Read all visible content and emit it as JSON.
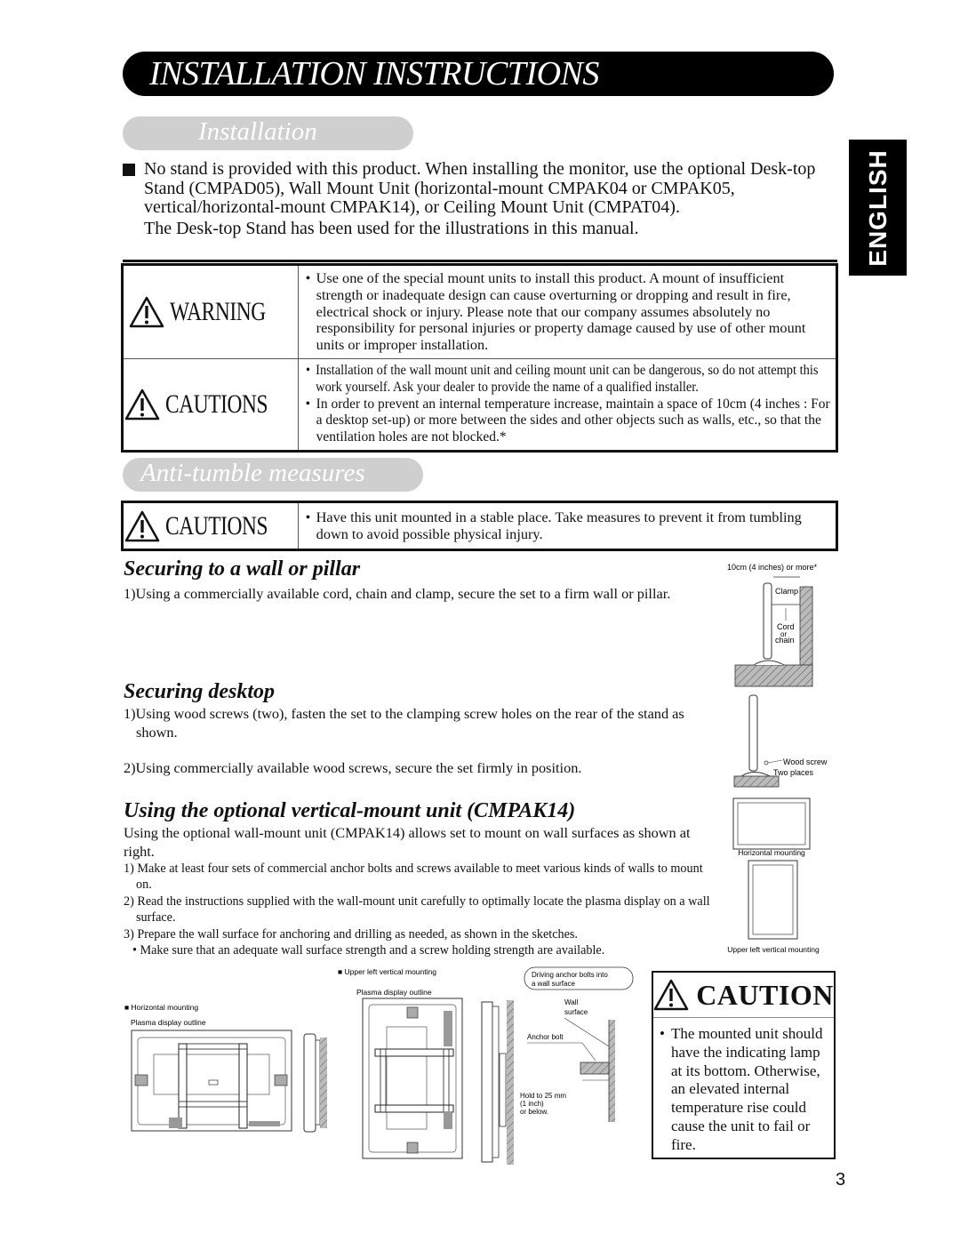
{
  "page": {
    "title": "INSTALLATION INSTRUCTIONS",
    "language_tab": "ENGLISH",
    "page_number": "3"
  },
  "installation": {
    "heading": "Installation",
    "intro_paragraph": "No stand is provided with this product. When installing the monitor, use the optional Desk-top Stand (CMPAD05), Wall Mount Unit (horizontal-mount CMPAK04 or CMPAK05, vertical/horizontal-mount CMPAK14), or Ceiling Mount Unit (CMPAT04).",
    "intro_note": "The Desk-top Stand has been used for the illustrations in this manual.",
    "notice_table": [
      {
        "label": "WARNING",
        "icon": "warning-triangle-icon",
        "items": [
          "Use one of the special mount units to install this product.  A mount of insufficient strength or inadequate design can cause overturning or dropping and result in fire, electrical shock or injury.  Please note that our company assumes absolutely no responsibility for personal injuries or property damage caused by use of other mount units or improper installation."
        ]
      },
      {
        "label": "CAUTIONS",
        "icon": "warning-triangle-icon",
        "items": [
          "Installation of the wall mount unit and ceiling mount unit can be dangerous, so do not attempt this work yourself. Ask your dealer to provide the name of a qualified installer.",
          "In order to prevent an internal temperature increase, maintain a space of 10cm (4 inches : For a desktop set-up) or more between the sides and other objects such as walls, etc., so that the ventilation holes are not blocked.*"
        ]
      }
    ]
  },
  "anti_tumble": {
    "heading": "Anti-tumble measures",
    "caution": {
      "label": "CAUTIONS",
      "icon": "warning-triangle-icon",
      "text": "Have this unit mounted in a stable place. Take measures to prevent it from tumbling down to avoid possible physical injury."
    },
    "wall_pillar": {
      "heading": "Securing to a wall or pillar",
      "steps": [
        "1)Using a commercially available cord, chain and clamp, secure the set to a firm wall or pillar."
      ],
      "figure_labels": {
        "distance": "10cm (4 inches) or more*",
        "clamp": "Clamp",
        "cord1": "Cord",
        "cord2": "or",
        "cord3": "chain"
      }
    },
    "desktop": {
      "heading": "Securing desktop",
      "steps": [
        "1)Using wood screws (two), fasten the set to the clamping screw holes on the rear of the stand as shown.",
        "2)Using commercially available wood screws, secure the set firmly in position."
      ],
      "figure_labels": {
        "screw": "Wood screw",
        "places": "Two places"
      }
    }
  },
  "vertical_mount": {
    "heading": "Using the optional vertical-mount unit (CMPAK14)",
    "intro": "Using the optional wall-mount unit (CMPAK14) allows set to mount on wall surfaces as shown at right.",
    "steps": [
      "1) Make at least four sets of commercial anchor bolts and screws available to meet various kinds of walls to mount on.",
      "2) Read the instructions supplied with the wall-mount unit carefully to optimally locate the plasma display on a wall surface.",
      "3) Prepare the wall surface for anchoring and drilling as needed, as shown in the sketches."
    ],
    "sub_bullet": "• Make sure that an adequate wall surface strength and a screw holding strength are available.",
    "figure_labels": {
      "horizontal": "Horizontal mounting",
      "upper_left_vertical": "Upper left vertical mounting",
      "horizontal_section": "■ Horizontal mounting",
      "vertical_section": "■ Upper left vertical mounting",
      "outline": "Plasma display outline",
      "anchor_callout_1": "Driving anchor bolts into",
      "anchor_callout_2": "a wall surface",
      "wall_1": "Wall",
      "wall_2": "surface",
      "anchor_bolt": "Anchor bolt",
      "hold_1": "Hold to 25 mm",
      "hold_2": "(1 inch)",
      "hold_3": "or below."
    }
  },
  "caution_box": {
    "label": "CAUTION",
    "icon": "warning-triangle-icon",
    "text": "The mounted unit should have the indicating lamp at its bottom. Otherwise, an elevated internal temperature rise could cause the unit to fail or fire."
  }
}
